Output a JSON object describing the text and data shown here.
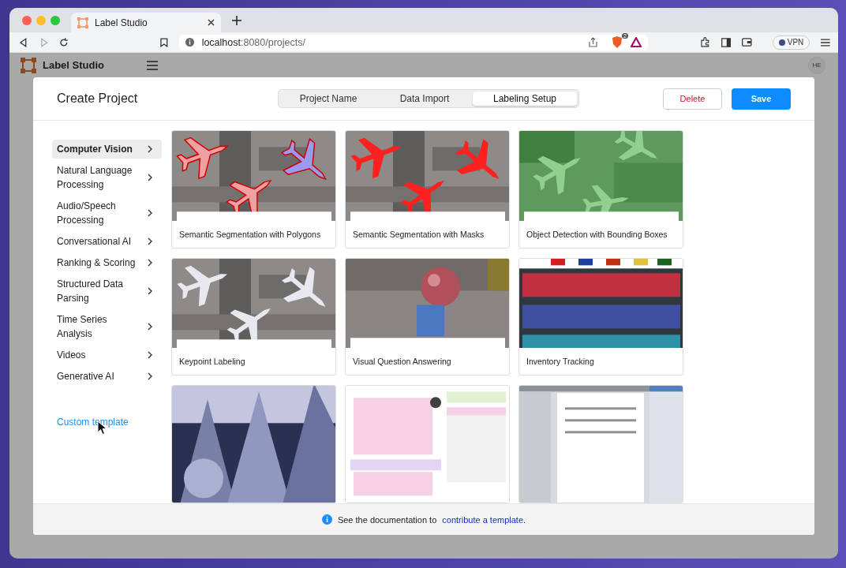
{
  "browser": {
    "tab_title": "Label Studio",
    "url_host": "localhost",
    "url_rest": ":8080/projects/",
    "shield_count": "2",
    "vpn": "VPN"
  },
  "app": {
    "logo": "Label Studio",
    "avatar": "HE"
  },
  "modal": {
    "title": "Create Project",
    "steps": [
      {
        "label": "Project Name",
        "selected": false
      },
      {
        "label": "Data Import",
        "selected": false
      },
      {
        "label": "Labeling Setup",
        "selected": true
      }
    ],
    "buttons": {
      "delete": "Delete",
      "save": "Save"
    },
    "categories": [
      {
        "label": "Computer Vision",
        "selected": true
      },
      {
        "label": "Natural Language Processing",
        "selected": false
      },
      {
        "label": "Audio/Speech Processing",
        "selected": false
      },
      {
        "label": "Conversational AI",
        "selected": false
      },
      {
        "label": "Ranking & Scoring",
        "selected": false
      },
      {
        "label": "Structured Data Parsing",
        "selected": false
      },
      {
        "label": "Time Series Analysis",
        "selected": false
      },
      {
        "label": "Videos",
        "selected": false
      },
      {
        "label": "Generative AI",
        "selected": false
      }
    ],
    "custom_template": "Custom template",
    "templates": [
      {
        "title": "Semantic Segmentation with Polygons",
        "kind": "polygons"
      },
      {
        "title": "Semantic Segmentation with Masks",
        "kind": "masks"
      },
      {
        "title": "Object Detection with Bounding Boxes",
        "kind": "boxes"
      },
      {
        "title": "Keypoint Labeling",
        "kind": "keypoints"
      },
      {
        "title": "Visual Question Answering",
        "kind": "vqa"
      },
      {
        "title": "Inventory Tracking",
        "kind": "shelf"
      },
      {
        "kind": "snow"
      },
      {
        "kind": "invoice"
      },
      {
        "kind": "document"
      }
    ],
    "footer": {
      "text": "See the documentation to",
      "link": "contribute a template",
      "end": "."
    }
  }
}
